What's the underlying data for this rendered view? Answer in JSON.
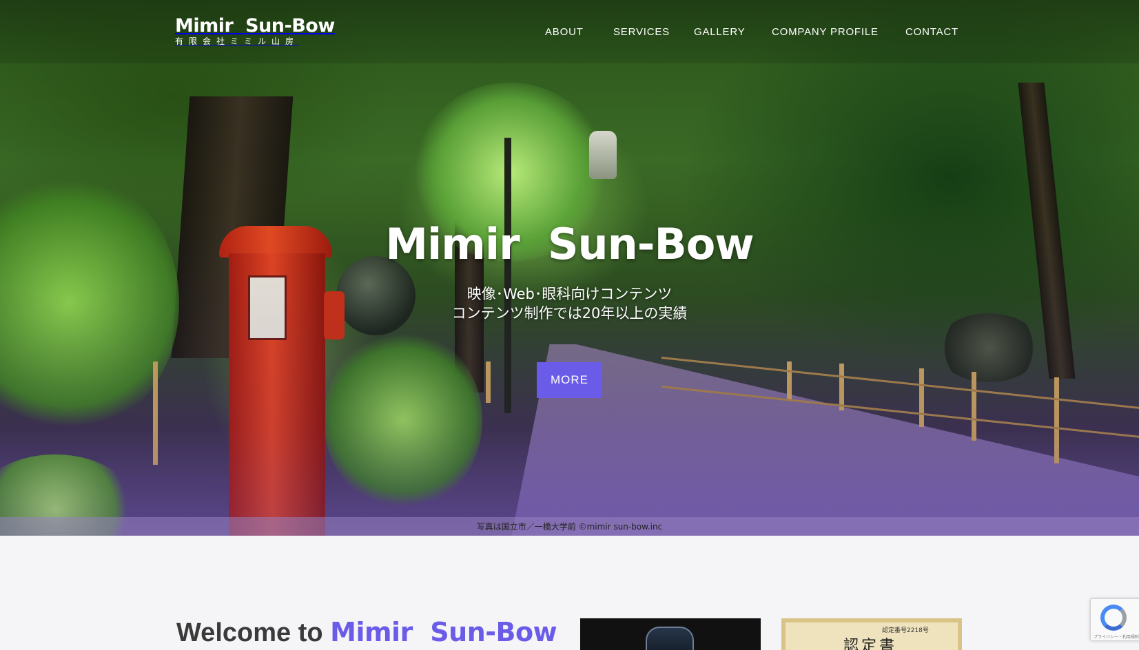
{
  "brand": {
    "logo_main": "Mimir  Sun-Bow",
    "logo_sub": "有限会社ミミル山房"
  },
  "nav": {
    "items": [
      {
        "label": "ABOUT"
      },
      {
        "label": "SERVICES"
      },
      {
        "label": "GALLERY"
      },
      {
        "label": "COMPANY PROFILE"
      },
      {
        "label": "CONTACT"
      }
    ]
  },
  "hero": {
    "title": "Mimir  Sun-Bow",
    "subtitle_line1": "映像･Web･眼科向けコンテンツ",
    "subtitle_line2": "コンテンツ制作では20年以上の実績",
    "button_label": "MORE",
    "photo_caption": "写真は国立市／一橋大学前 ©mimir sun-bow.inc"
  },
  "welcome": {
    "prefix": "Welcome to ",
    "brand": "Mimir  Sun-Bow"
  },
  "certificate": {
    "number": "認定番号2218号",
    "title": "認定書"
  },
  "recaptcha": {
    "links": "プライバシー・利用規約"
  },
  "colors": {
    "accent": "#6a5ce8",
    "page_bg": "#f5f4f7",
    "postbox_red": "#e04421"
  }
}
